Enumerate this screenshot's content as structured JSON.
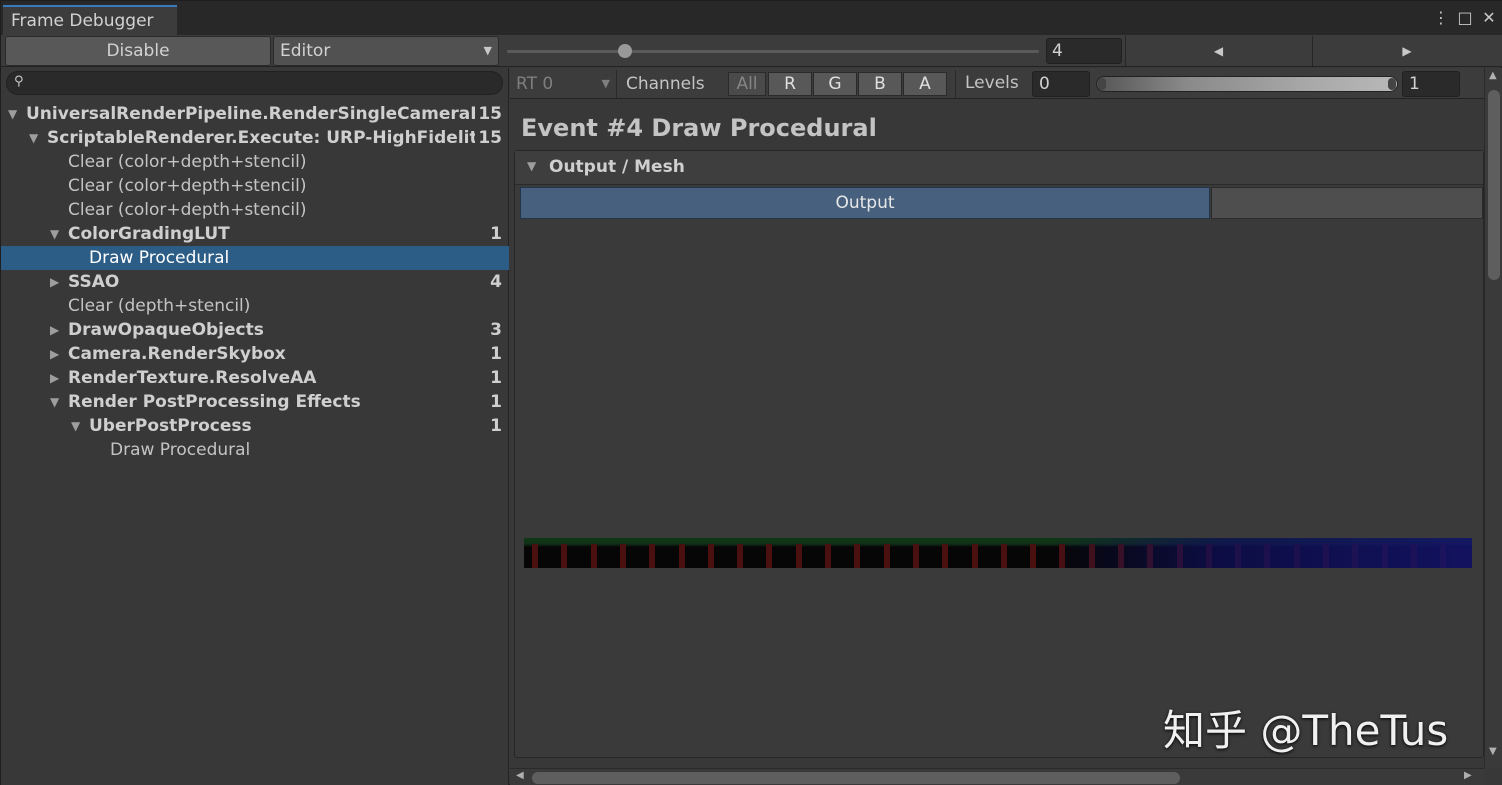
{
  "window": {
    "tab_title": "Frame Debugger",
    "icons": [
      "kebab-menu-icon",
      "maximize-icon",
      "close-icon"
    ]
  },
  "toolbar": {
    "disable_label": "Disable",
    "target_dropdown": "Editor",
    "event_index": "4",
    "slider_fraction": 0.22
  },
  "tree": {
    "search_placeholder": "",
    "items": [
      {
        "label": "UniversalRenderPipeline.RenderSingleCameraInte",
        "count": "15",
        "depth": 0,
        "expanded": true,
        "bold": true
      },
      {
        "label": "ScriptableRenderer.Execute: URP-HighFidelity-",
        "count": "15",
        "depth": 1,
        "expanded": true,
        "bold": true
      },
      {
        "label": "Clear (color+depth+stencil)",
        "count": "",
        "depth": 2,
        "leaf": true
      },
      {
        "label": "Clear (color+depth+stencil)",
        "count": "",
        "depth": 2,
        "leaf": true
      },
      {
        "label": "Clear (color+depth+stencil)",
        "count": "",
        "depth": 2,
        "leaf": true
      },
      {
        "label": "ColorGradingLUT",
        "count": "1",
        "depth": 2,
        "expanded": true,
        "bold": true
      },
      {
        "label": "Draw Procedural",
        "count": "",
        "depth": 3,
        "leaf": true,
        "selected": true
      },
      {
        "label": "SSAO",
        "count": "4",
        "depth": 2,
        "expanded": false,
        "bold": true
      },
      {
        "label": "Clear (depth+stencil)",
        "count": "",
        "depth": 2,
        "leaf": true
      },
      {
        "label": "DrawOpaqueObjects",
        "count": "3",
        "depth": 2,
        "expanded": false,
        "bold": true
      },
      {
        "label": "Camera.RenderSkybox",
        "count": "1",
        "depth": 2,
        "expanded": false,
        "bold": true
      },
      {
        "label": "RenderTexture.ResolveAA",
        "count": "1",
        "depth": 2,
        "expanded": false,
        "bold": true
      },
      {
        "label": "Render PostProcessing Effects",
        "count": "1",
        "depth": 2,
        "expanded": true,
        "bold": true
      },
      {
        "label": "UberPostProcess",
        "count": "1",
        "depth": 3,
        "expanded": true,
        "bold": true
      },
      {
        "label": "Draw Procedural",
        "count": "",
        "depth": 4,
        "leaf": true
      }
    ]
  },
  "rt_bar": {
    "rt_dropdown": "RT 0",
    "channels_label": "Channels",
    "channels": [
      "All",
      "R",
      "G",
      "B",
      "A"
    ],
    "levels_label": "Levels",
    "levels_min": "0",
    "levels_max": "1"
  },
  "event": {
    "title": "Event #4 Draw Procedural",
    "section_label": "Output / Mesh",
    "output_tab": "Output"
  },
  "watermark": "知乎 @TheTus",
  "colors": {
    "selection": "#2c5d87",
    "output_tab": "#46607e",
    "accent": "#3a79bb"
  }
}
